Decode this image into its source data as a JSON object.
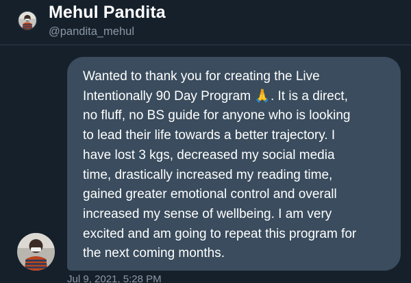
{
  "profile": {
    "display_name": "Mehul Pandita",
    "handle": "@pandita_mehul"
  },
  "message": {
    "text": "Wanted to thank you for creating the Live\nIntentionally 90 Day Program 🙏. It is a direct,\nno fluff, no BS guide for anyone who is looking\nto lead their life towards a better trajectory. I\nhave lost 3 kgs, decreased my social media\ntime, drastically increased my reading time,\ngained greater emotional control and overall\nincreased my sense of wellbeing. I am very\nexcited and am going to repeat this program for\nthe next coming months.",
    "timestamp": "Jul 9, 2021, 5:28 PM"
  },
  "colors": {
    "background": "#15202b",
    "bubble": "#3a4c5d",
    "secondary_text": "#8b98a5"
  }
}
